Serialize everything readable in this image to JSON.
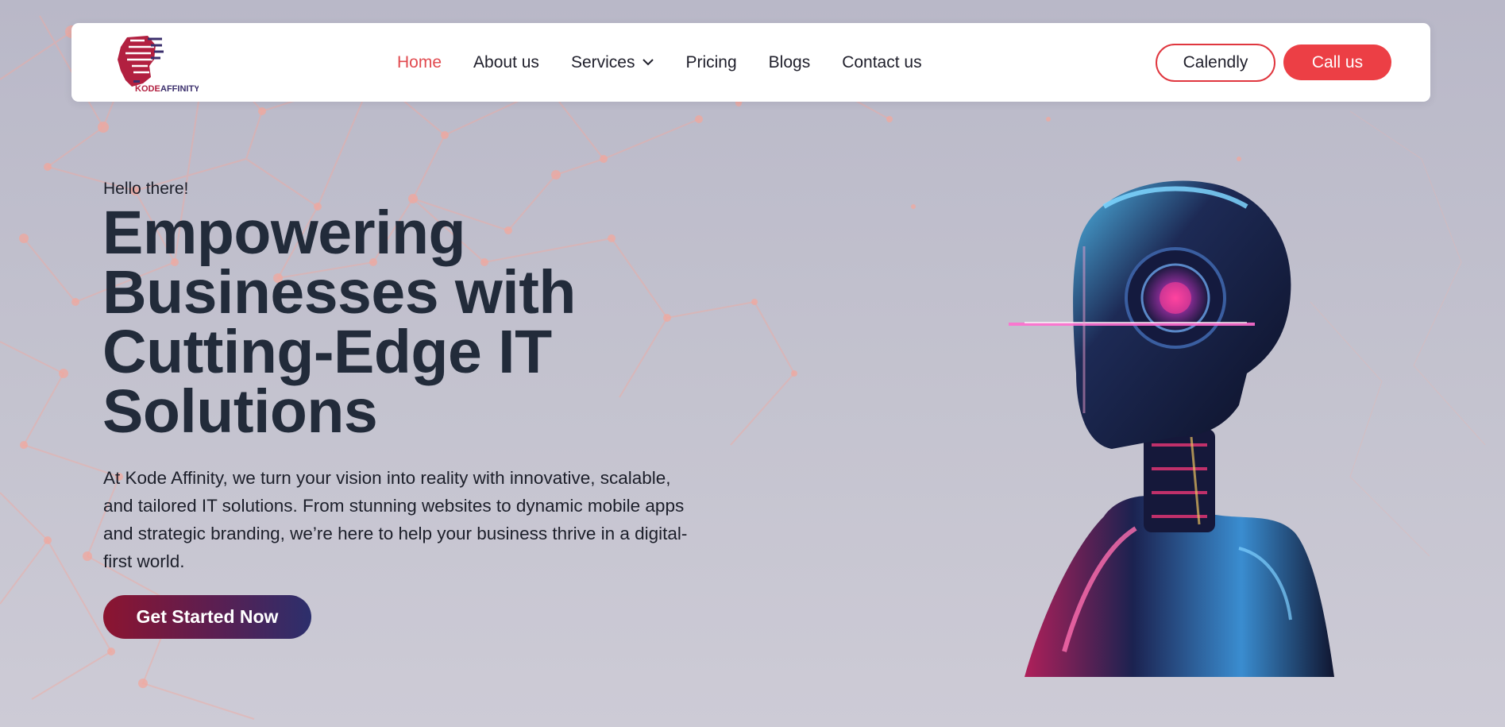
{
  "brand": {
    "logo_text": "KODEAFFINITY",
    "accent_color": "#ec3f45",
    "text_color": "#222b3a"
  },
  "nav": {
    "items": [
      {
        "label": "Home",
        "active": true
      },
      {
        "label": "About us"
      },
      {
        "label": "Services",
        "has_dropdown": true
      },
      {
        "label": "Pricing"
      },
      {
        "label": "Blogs"
      },
      {
        "label": "Contact us"
      }
    ],
    "calendly_label": "Calendly",
    "call_label": "Call us"
  },
  "hero": {
    "eyebrow": "Hello there!",
    "title_lines": [
      "Empowering",
      "Businesses with",
      "Cutting-Edge IT",
      "Solutions"
    ],
    "description": "At Kode Affinity, we turn your vision into reality with innovative, scalable, and tailored IT solutions. From stunning websites to dynamic mobile apps and strategic branding, we’re here to help your business thrive in a digital-first world.",
    "cta_label": "Get Started Now"
  },
  "icons": [
    "chevron-down-icon",
    "robot-illustration",
    "network-background"
  ]
}
